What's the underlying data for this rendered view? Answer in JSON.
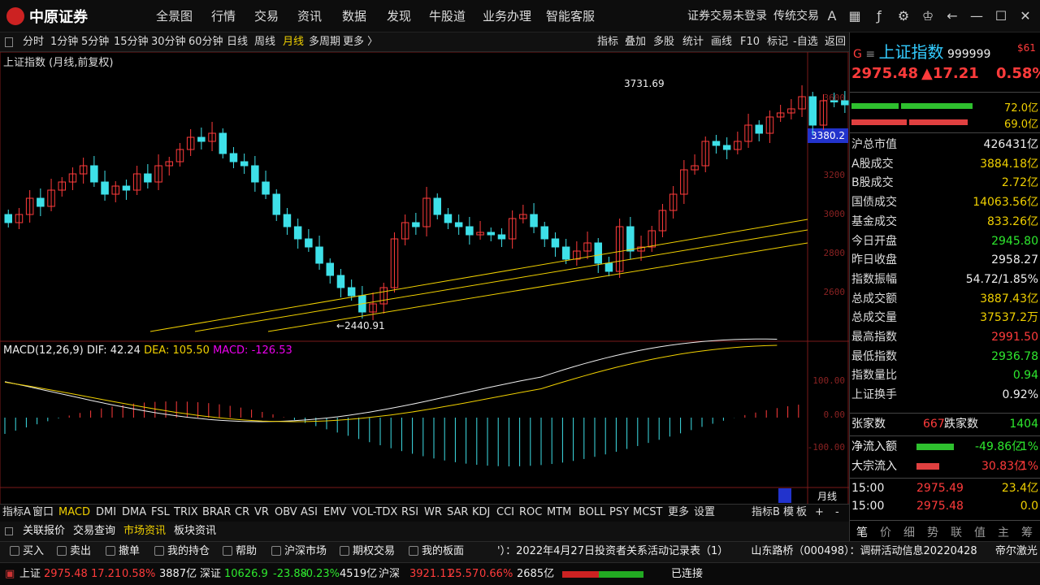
{
  "app": {
    "logo_text": "中原证券",
    "menu": [
      "全景图",
      "行情",
      "交易",
      "资讯",
      "数据",
      "发现",
      "牛股道",
      "业务办理",
      "智能客服"
    ],
    "login_status": "证券交易未登录",
    "trade_mode": "传统交易",
    "window_icons": [
      "font-size-icon",
      "calc-icon",
      "formula-icon",
      "settings-icon",
      "shirt-icon",
      "back-icon",
      "minimize-icon",
      "maximize-icon",
      "close-icon"
    ]
  },
  "periods": {
    "items": [
      "分时",
      "1分钟",
      "5分钟",
      "15分钟",
      "30分钟",
      "60分钟",
      "日线",
      "周线",
      "月线",
      "多周期",
      "更多 〉"
    ],
    "active": "月线"
  },
  "tools": [
    "指标",
    "叠加",
    "多股",
    "统计",
    "画线",
    "F10",
    "标记",
    "-自选",
    "返回"
  ],
  "chart_title": "上证指数 (月线,前复权)",
  "annotations": {
    "high_label": "3731.69",
    "low_label": "←2440.91",
    "price_tag": "3380.2"
  },
  "right_axis_ticks": [
    "3600",
    "3200",
    "3000",
    "2800",
    "2600"
  ],
  "macd": {
    "label": "MACD(12,26,9)",
    "dif": "DIF: 42.24",
    "dea": "DEA: 105.50",
    "macd": "MACD: -126.53",
    "axis_ticks": [
      "100.00",
      "0.00",
      "-100.00"
    ]
  },
  "time_axis_label": "月线",
  "indicator_tabs": [
    "指标A",
    "窗口",
    "MACD",
    "DMI",
    "DMA",
    "FSL",
    "TRIX",
    "BRAR",
    "CR",
    "VR",
    "OBV",
    "ASI",
    "EMV",
    "VOL-TDX",
    "RSI",
    "WR",
    "SAR",
    "KDJ",
    "CCI",
    "ROC",
    "MTM",
    "BOLL",
    "PSY",
    "MCST",
    "更多",
    "设置"
  ],
  "indicator_active": "MACD",
  "indicator_right": [
    "指标B",
    "模",
    "板",
    "+",
    "-"
  ],
  "news_tabs": [
    "关联报价",
    "交易查询",
    "市场资讯",
    "板块资讯"
  ],
  "news_active": "市场资讯",
  "quick_actions": [
    "买入",
    "卖出",
    "撤单",
    "我的持仓",
    "帮助",
    "沪深市场",
    "期权交易",
    "我的板面"
  ],
  "ticker_news": [
    "'）：2022年4月27日投资者关系活动记录表（1）",
    "山东路桥（000498）：调研活动信息20220428",
    "帝尔激光（3"
  ],
  "status": {
    "sh_label": "上证",
    "sh_price": "2975.48",
    "sh_change": "17.21",
    "sh_pct": "0.58%",
    "sh_amount": "3887亿",
    "sz_label": "深证",
    "sz_price": "10626.9",
    "sz_change": "-23.88",
    "sz_pct": "-0.23%",
    "sz_amount": "4519亿",
    "hs_label": "沪深",
    "hs_price": "3921.11",
    "hs_change": "25.57",
    "hs_pct": "0.66%",
    "hs_amount": "2685亿",
    "conn": "已连接"
  },
  "quote": {
    "g_label": "G",
    "name": "上证指数",
    "code": "999999",
    "tag": "$61",
    "price": "2975.48",
    "change": "▲17.21",
    "pct": "0.58%",
    "bar1": "72.0亿",
    "bar2": "69.0亿",
    "rows": [
      {
        "k": "沪总市值",
        "v": "426431亿",
        "c": "white"
      },
      {
        "k": "A股成交",
        "v": "3884.18亿",
        "c": "yellow"
      },
      {
        "k": "B股成交",
        "v": "2.72亿",
        "c": "yellow"
      },
      {
        "k": "国债成交",
        "v": "14063.56亿",
        "c": "yellow"
      },
      {
        "k": "基金成交",
        "v": "833.26亿",
        "c": "yellow"
      },
      {
        "k": "今日开盘",
        "v": "2945.80",
        "c": "green"
      },
      {
        "k": "昨日收盘",
        "v": "2958.27",
        "c": "white"
      },
      {
        "k": "指数振幅",
        "v": "54.72/1.85%",
        "c": "white"
      },
      {
        "k": "总成交额",
        "v": "3887.43亿",
        "c": "yellow"
      },
      {
        "k": "总成交量",
        "v": "37537.2万",
        "c": "yellow"
      },
      {
        "k": "最高指数",
        "v": "2991.50",
        "c": "red"
      },
      {
        "k": "最低指数",
        "v": "2936.78",
        "c": "green"
      },
      {
        "k": "指数量比",
        "v": "0.94",
        "c": "green"
      },
      {
        "k": "上证换手",
        "v": "0.92%",
        "c": "white"
      }
    ],
    "up_label": "张家数",
    "up_count": "667",
    "down_label": "跌家数",
    "down_count": "1404",
    "flow1_label": "净流入额",
    "flow1_val": "-49.86亿",
    "flow1_pct": "-1%",
    "flow2_label": "大宗流入",
    "flow2_val": "30.83亿",
    "flow2_pct": "1%",
    "ticks": [
      {
        "t": "15:00",
        "p": "2975.49",
        "v": "23.4亿"
      },
      {
        "t": "15:00",
        "p": "2975.48",
        "v": "0.0"
      }
    ],
    "tabs": [
      "笔",
      "价",
      "细",
      "势",
      "联",
      "值",
      "主",
      "筹"
    ]
  },
  "colors": {
    "up": "#ff3b3b",
    "down": "#3ee0e8",
    "yellow": "#f0d000",
    "magenta": "#e040e0"
  }
}
